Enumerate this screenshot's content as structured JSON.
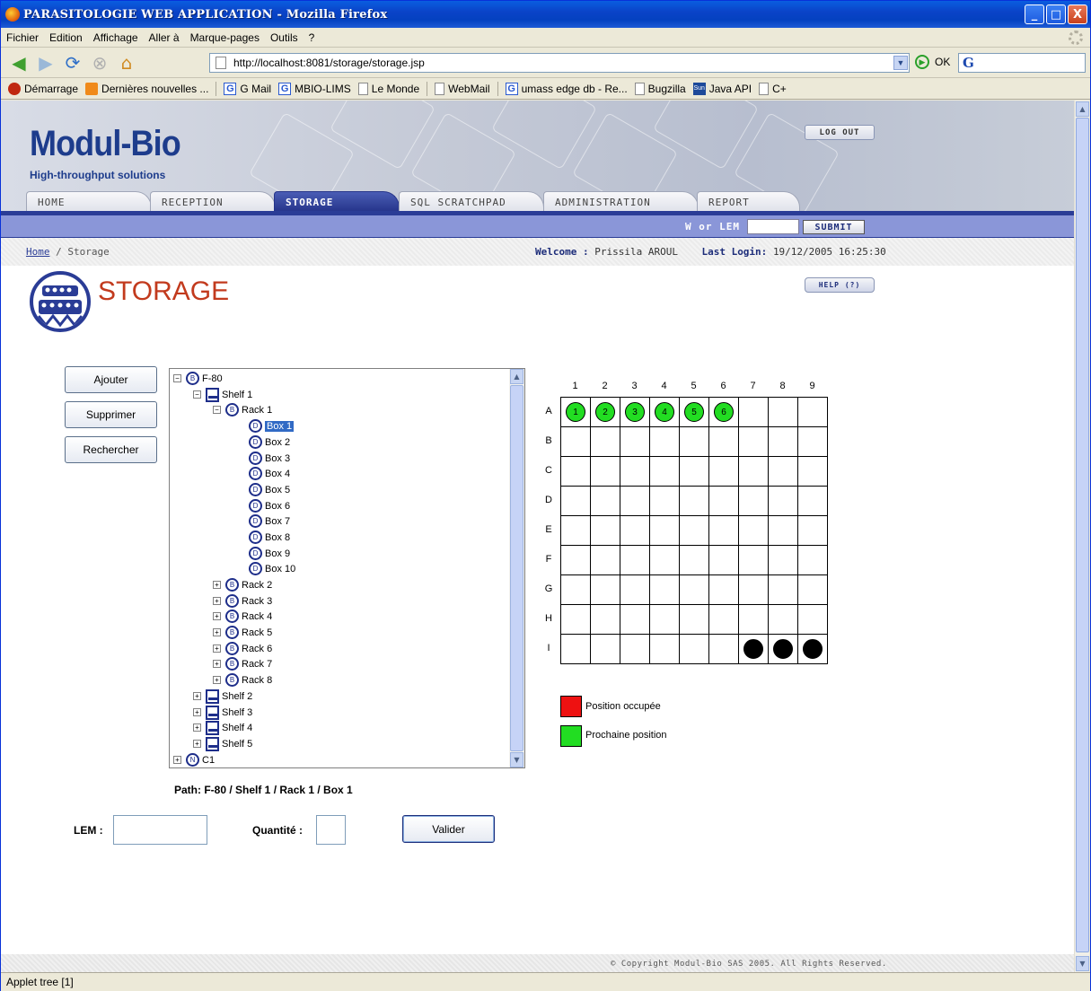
{
  "window": {
    "title": "PARASITOLOGIE WEB APPLICATION - Mozilla Firefox",
    "controls": [
      "_",
      "□",
      "X"
    ]
  },
  "menu": [
    "Fichier",
    "Edition",
    "Affichage",
    "Aller à",
    "Marque-pages",
    "Outils",
    "?"
  ],
  "navigation": {
    "url": "http://localhost:8081/storage/storage.jsp",
    "go_label": "OK",
    "search_engine_glyph": "G"
  },
  "bookmarks": [
    {
      "label": "Démarrage",
      "icon": "red"
    },
    {
      "label": "Dernières nouvelles ...",
      "icon": "rss"
    },
    {
      "label": "G Mail",
      "icon": "g"
    },
    {
      "label": "MBIO-LIMS",
      "icon": "g"
    },
    {
      "label": "Le Monde",
      "icon": "page"
    },
    {
      "label": "WebMail",
      "icon": "page"
    },
    {
      "label": "umass edge db - Re...",
      "icon": "g"
    },
    {
      "label": "Bugzilla",
      "icon": "page"
    },
    {
      "label": "Java API",
      "icon": "sun"
    },
    {
      "label": "C+",
      "icon": "page"
    }
  ],
  "header": {
    "logo": "Modul-Bio",
    "tagline": "High-throughput solutions",
    "logout": "LOG OUT",
    "tabs": [
      "HOME",
      "RECEPTION",
      "STORAGE",
      "SQL SCRATCHPAD",
      "ADMINISTRATION",
      "REPORT"
    ],
    "active_tab": "STORAGE",
    "search_label": "W or LEM",
    "search_value": "",
    "submit": "SUBMIT"
  },
  "breadcrumb": {
    "home": "Home",
    "separator": "/",
    "current": "Storage"
  },
  "session": {
    "welcome_label": "Welcome :",
    "user": "Prissila AROUL",
    "last_login_label": "Last Login:",
    "last_login": "19/12/2005 16:25:30"
  },
  "page": {
    "title": "STORAGE",
    "help": "HELP (?)"
  },
  "actions": [
    "Ajouter",
    "Supprimer",
    "Rechercher"
  ],
  "tree": {
    "root": "F-80",
    "shelf1": "Shelf 1",
    "rack1": "Rack 1",
    "boxes": [
      "Box 1",
      "Box 2",
      "Box 3",
      "Box 4",
      "Box 5",
      "Box 6",
      "Box 7",
      "Box 8",
      "Box 9",
      "Box 10"
    ],
    "racks": [
      "Rack 2",
      "Rack 3",
      "Rack 4",
      "Rack 5",
      "Rack 6",
      "Rack 7",
      "Rack 8"
    ],
    "shelves": [
      "Shelf 2",
      "Shelf 3",
      "Shelf 4",
      "Shelf 5"
    ],
    "other_root": "C1",
    "selected": "Box 1",
    "root_icon_glyph": "B",
    "box_icon_glyph": "D",
    "other_icon_glyph": "N"
  },
  "path": "Path: F-80 / Shelf 1 / Rack 1 / Box 1",
  "form": {
    "lem_label": "LEM :",
    "lem_value": "",
    "quantity_label": "Quantité :",
    "quantity_value": "",
    "submit": "Valider"
  },
  "grid": {
    "columns": [
      "1",
      "2",
      "3",
      "4",
      "5",
      "6",
      "7",
      "8",
      "9"
    ],
    "rows": [
      "A",
      "B",
      "C",
      "D",
      "E",
      "F",
      "G",
      "H",
      "I"
    ],
    "next_positions": [
      {
        "row": "A",
        "col": 1,
        "label": "1"
      },
      {
        "row": "A",
        "col": 2,
        "label": "2"
      },
      {
        "row": "A",
        "col": 3,
        "label": "3"
      },
      {
        "row": "A",
        "col": 4,
        "label": "4"
      },
      {
        "row": "A",
        "col": 5,
        "label": "5"
      },
      {
        "row": "A",
        "col": 6,
        "label": "6"
      }
    ],
    "filled_positions": [
      {
        "row": "I",
        "col": 7
      },
      {
        "row": "I",
        "col": 8
      },
      {
        "row": "I",
        "col": 9
      }
    ]
  },
  "legend": [
    {
      "label": "Position occupée",
      "color": "#ee1111"
    },
    {
      "label": "Prochaine position",
      "color": "#22dd22"
    }
  ],
  "footer": {
    "copyright": "© Copyright Modul-Bio SAS 2005. All Rights Reserved."
  },
  "status": "Applet tree [1]"
}
